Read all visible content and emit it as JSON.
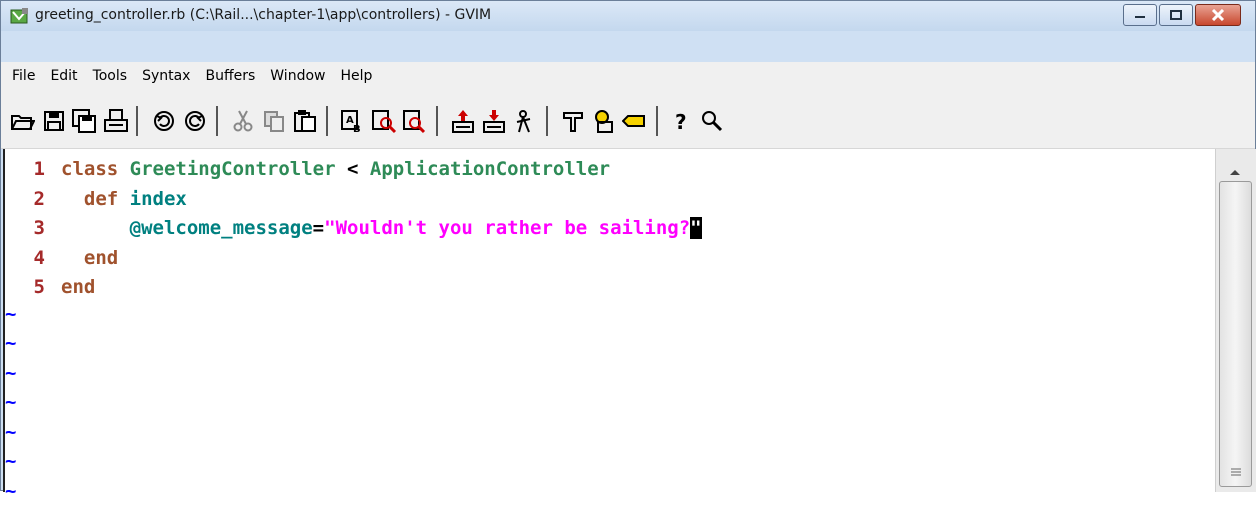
{
  "window": {
    "title": "greeting_controller.rb (C:\\Rail...\\chapter-1\\app\\controllers) - GVIM"
  },
  "menu": [
    "File",
    "Edit",
    "Tools",
    "Syntax",
    "Buffers",
    "Window",
    "Help"
  ],
  "toolbar": {
    "icons": [
      "open-icon",
      "save-icon",
      "save-all-icon",
      "print-icon",
      "undo-icon",
      "redo-icon",
      "cut-icon",
      "copy-icon",
      "paste-icon",
      "find-replace-icon",
      "find-next-icon",
      "find-prev-icon",
      "load-session-icon",
      "save-session-icon",
      "run-script-icon",
      "make-icon",
      "run-ctags-icon",
      "jump-tag-icon",
      "help-icon",
      "find-help-icon"
    ]
  },
  "editor": {
    "lines": [
      {
        "num": "1",
        "indent": "",
        "parts": [
          {
            "t": "class ",
            "c": "kw"
          },
          {
            "t": "GreetingController",
            "c": "cls"
          },
          {
            "t": " < ",
            "c": "op"
          },
          {
            "t": "ApplicationController",
            "c": "cls"
          }
        ]
      },
      {
        "num": "2",
        "indent": "  ",
        "parts": [
          {
            "t": "def ",
            "c": "kw"
          },
          {
            "t": "index",
            "c": "plain"
          }
        ]
      },
      {
        "num": "3",
        "indent": "      ",
        "parts": [
          {
            "t": "@welcome_message",
            "c": "ivar"
          },
          {
            "t": "=",
            "c": "op"
          },
          {
            "t": "\"Wouldn't you rather be sailing?",
            "c": "str"
          },
          {
            "t": "\"",
            "c": "str"
          }
        ]
      },
      {
        "num": "4",
        "indent": "  ",
        "parts": [
          {
            "t": "end",
            "c": "kw"
          }
        ]
      },
      {
        "num": "5",
        "indent": "",
        "parts": [
          {
            "t": "end",
            "c": "kw"
          }
        ]
      }
    ],
    "tilde": "~",
    "tilde_count": 7
  }
}
